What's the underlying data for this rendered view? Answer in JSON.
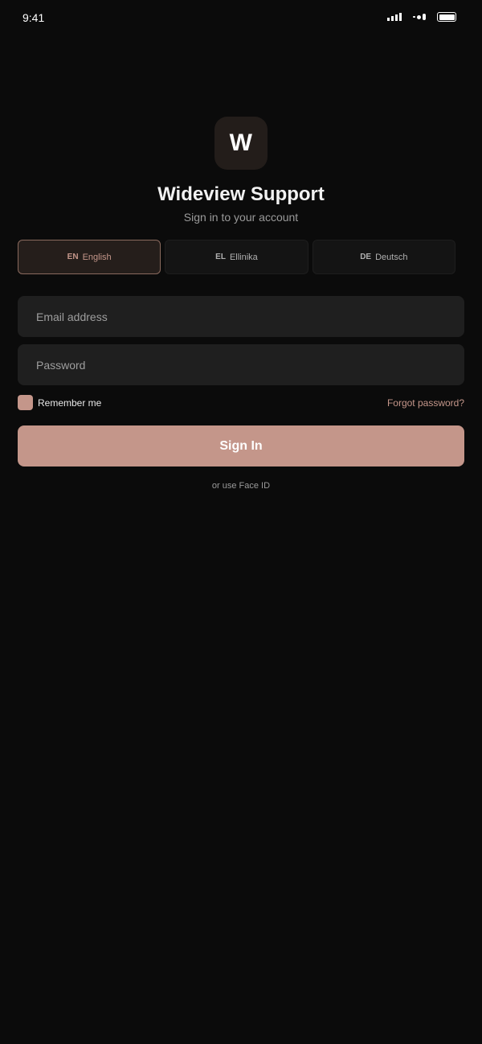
{
  "status_bar": {
    "time": "9:41",
    "icons": [
      "signal-icon",
      "wifi-icon",
      "battery-icon"
    ]
  },
  "brand": {
    "logo_letter": "W",
    "title": "Wideview Support",
    "subtitle": "Sign in to your account",
    "accent_color": "#c4968a",
    "background_color": "#0b0b0b"
  },
  "languages": [
    {
      "code": "EN",
      "label": "English",
      "selected": true
    },
    {
      "code": "EL",
      "label": "Ellinika",
      "selected": false
    },
    {
      "code": "DE",
      "label": "Deutsch",
      "selected": false
    }
  ],
  "form": {
    "email": {
      "placeholder": "Email address",
      "value": ""
    },
    "password": {
      "placeholder": "Password",
      "value": ""
    },
    "remember_label": "Remember me",
    "remember_checked": true,
    "forgot_label": "Forgot password?",
    "submit_label": "Sign In",
    "faceid_label": "or use Face ID"
  }
}
